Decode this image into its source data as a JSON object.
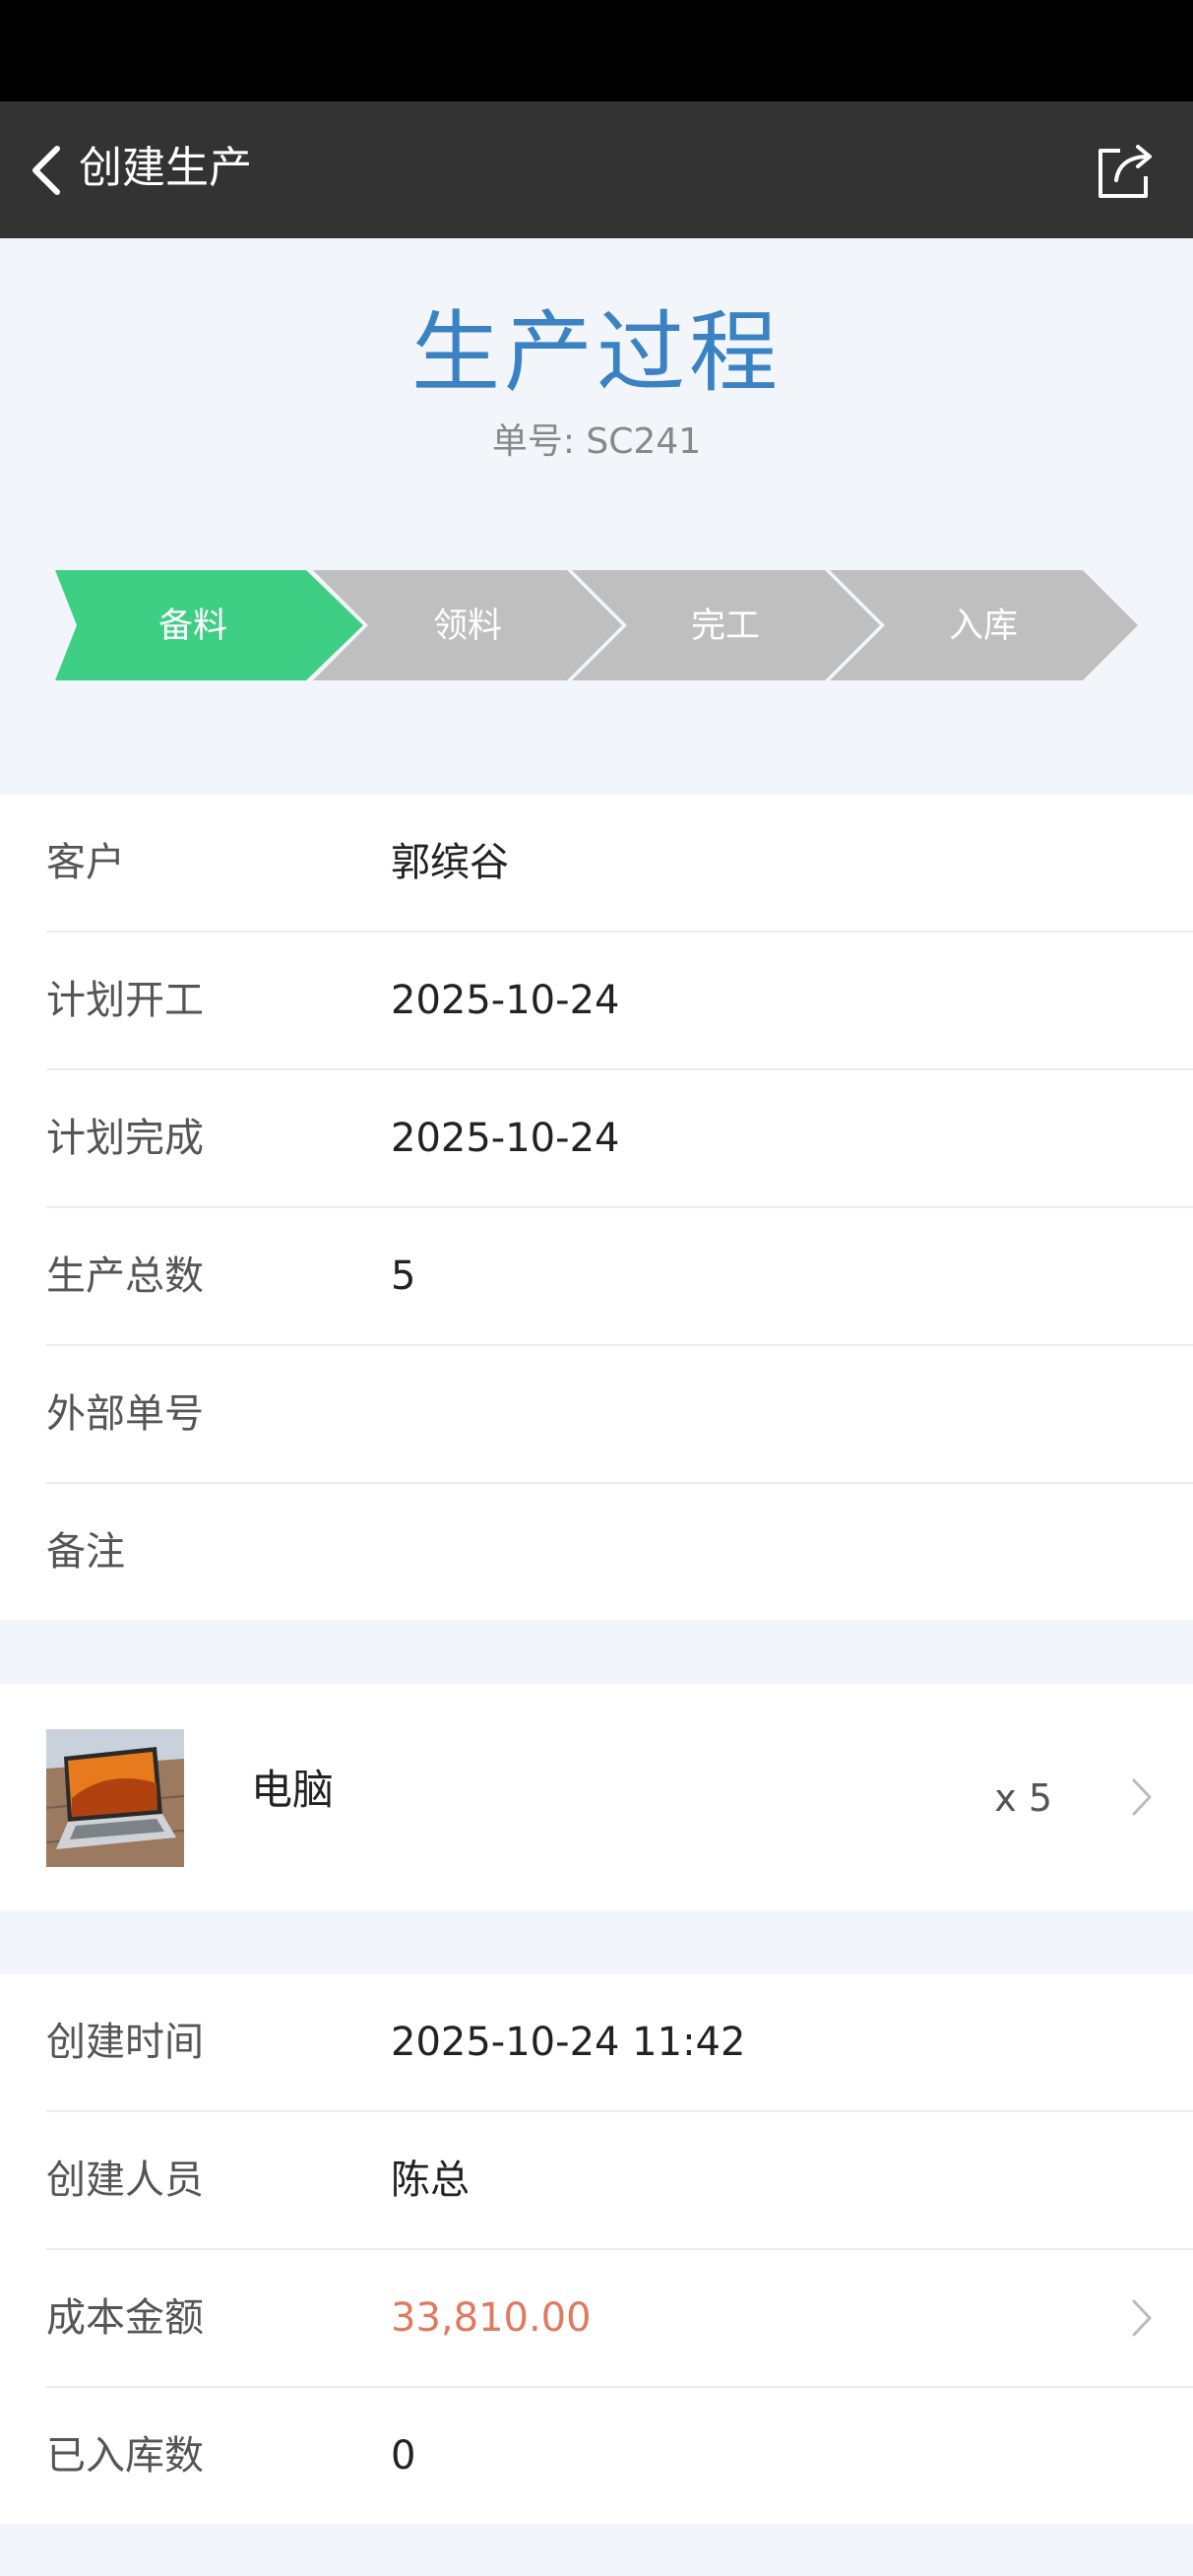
{
  "nav": {
    "title": "创建生产",
    "back_icon": "chevron-left-icon",
    "share_icon": "share-icon"
  },
  "header": {
    "title": "生产过程",
    "order_no": "单号: SC241"
  },
  "steps": [
    {
      "label": "备料",
      "active": true
    },
    {
      "label": "领料",
      "active": false
    },
    {
      "label": "完工",
      "active": false
    },
    {
      "label": "入库",
      "active": false
    }
  ],
  "info": {
    "customer": {
      "label": "客户",
      "value": "郭缤谷"
    },
    "plan_start": {
      "label": "计划开工",
      "value": "2025-10-24"
    },
    "plan_finish": {
      "label": "计划完成",
      "value": "2025-10-24"
    },
    "total": {
      "label": "生产总数",
      "value": "5"
    },
    "external_no": {
      "label": "外部单号",
      "value": ""
    },
    "remark": {
      "label": "备注",
      "value": ""
    }
  },
  "product": {
    "name": "电脑",
    "qty": "x 5"
  },
  "meta": {
    "created_time": {
      "label": "创建时间",
      "value": "2025-10-24 11:42"
    },
    "creator": {
      "label": "创建人员",
      "value": "陈总"
    },
    "cost": {
      "label": "成本金额",
      "value": "33,810.00"
    },
    "stocked": {
      "label": "已入库数",
      "value": "0"
    }
  },
  "colors": {
    "accent": "#3b82c4",
    "step_active": "#3ecf84",
    "step_inactive": "#bfbfbf",
    "money": "#e07a5f",
    "navbar": "#333333"
  }
}
